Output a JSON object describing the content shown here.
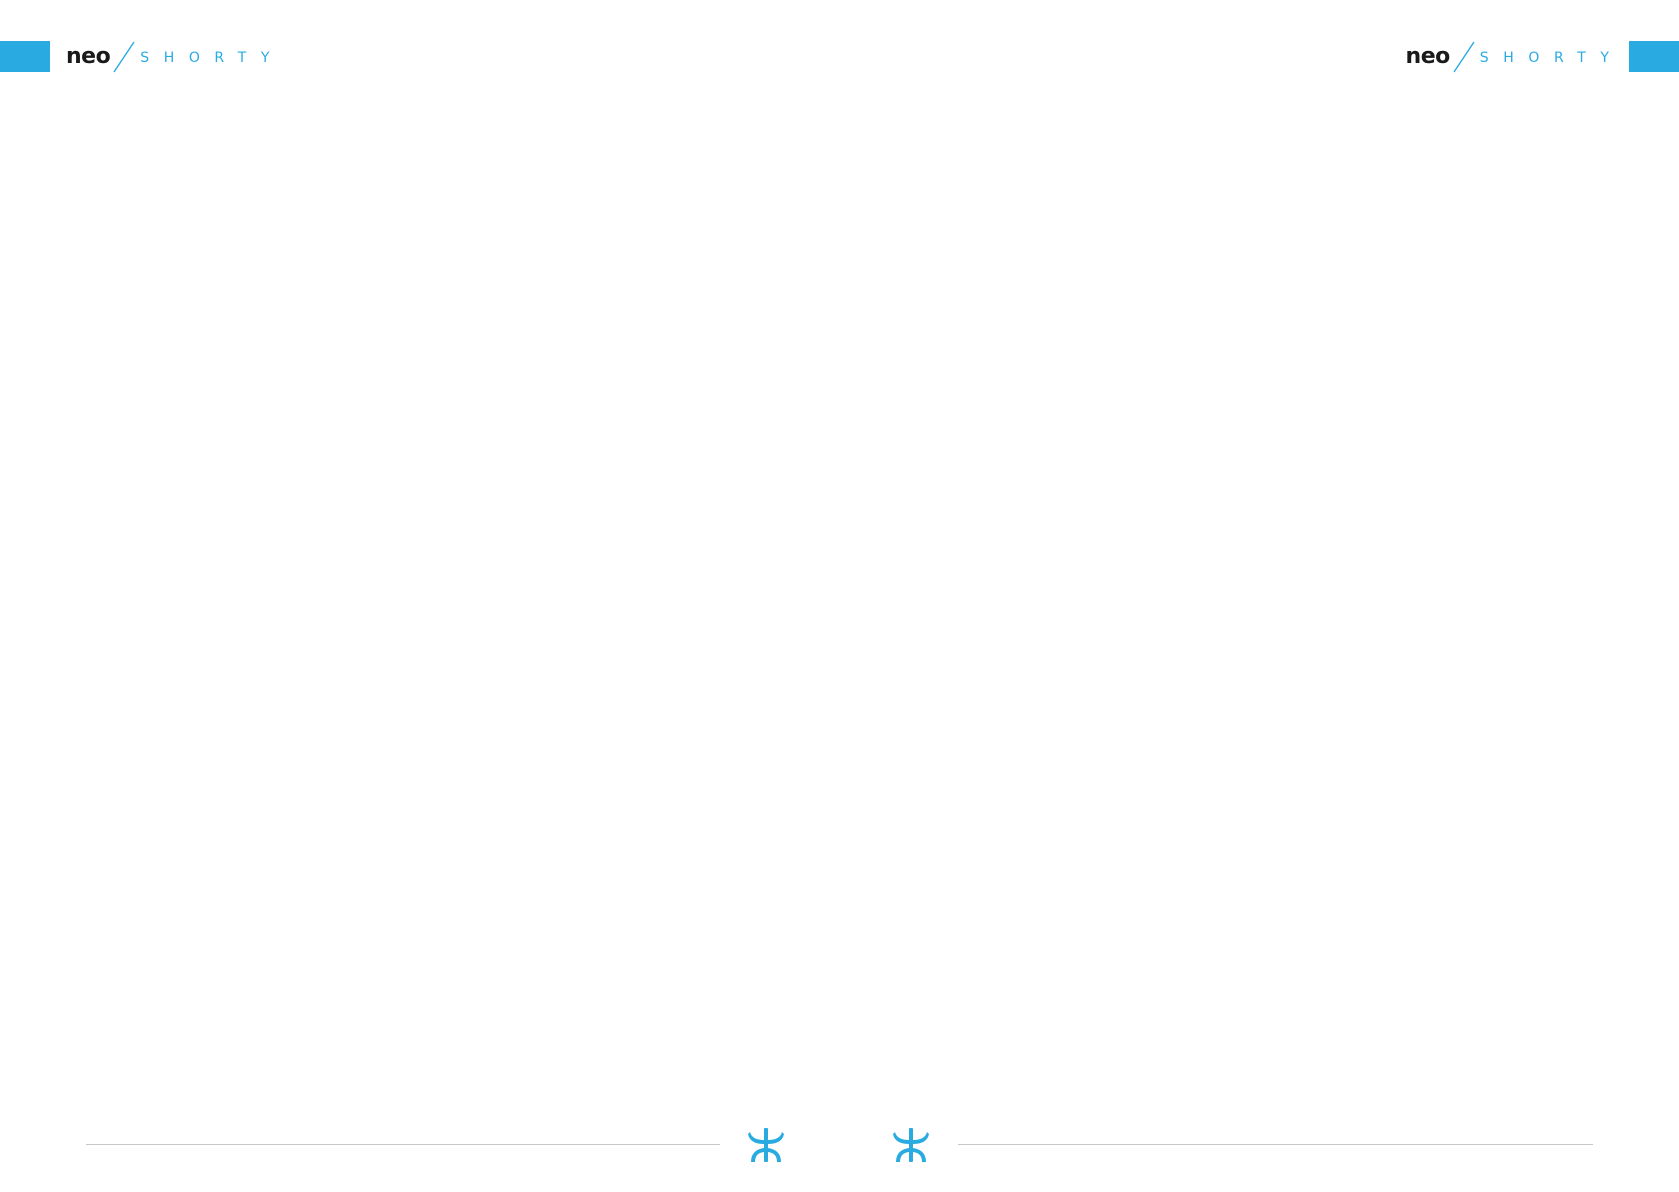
{
  "brand": {
    "word_primary": "neo",
    "word_secondary": "SHORTY",
    "accent_color": "#29abe2",
    "primary_color": "#1a1a1a"
  },
  "pages": [
    {
      "side": "left"
    },
    {
      "side": "right"
    }
  ],
  "footer": {
    "emblem_icon": "propeller-emblem-icon",
    "rule_color": "#c8c8c8"
  }
}
